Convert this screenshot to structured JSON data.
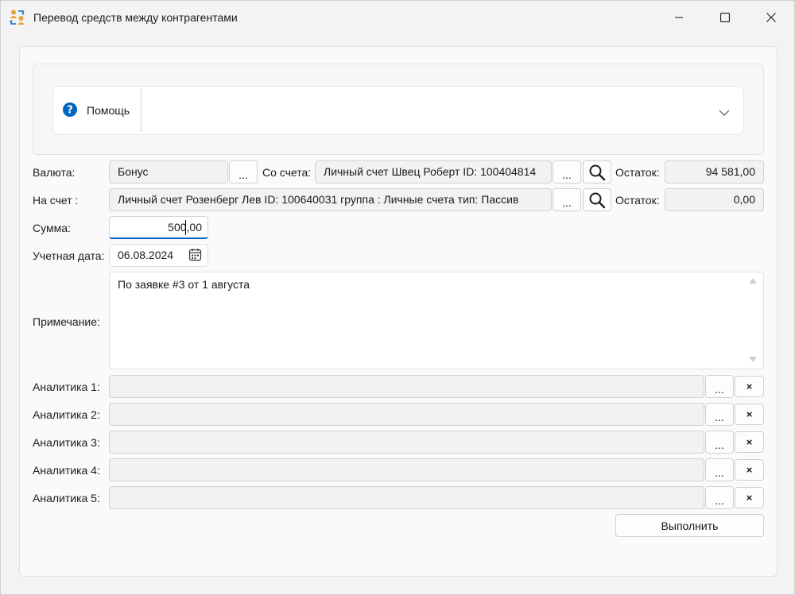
{
  "window": {
    "title": "Перевод средств между контрагентами",
    "accent": "#005fb8"
  },
  "help": {
    "label": "Помощь"
  },
  "currency": {
    "label": "Валюта:",
    "value": "Бонус",
    "browse_label": "..."
  },
  "from_account": {
    "label": "Со счета:",
    "value": "Личный счет Швец Роберт ID: 100404814",
    "browse_label": "...",
    "balance_label": "Остаток:",
    "balance_value": "94 581,00"
  },
  "to_account": {
    "label": "На счет :",
    "value": "Личный счет Розенберг Лев ID: 100640031 группа : Личные счета тип: Пассив",
    "browse_label": "...",
    "balance_label": "Остаток:",
    "balance_value": "0,00"
  },
  "amount": {
    "label": "Сумма:",
    "value": "500,00"
  },
  "date": {
    "label": "Учетная дата:",
    "value": "06.08.2024"
  },
  "note": {
    "label": "Примечание:",
    "value": "По заявке #3 от 1 августа"
  },
  "analytics": [
    {
      "label": "Аналитика 1:",
      "value": "",
      "browse_label": "...",
      "clear_label": "×"
    },
    {
      "label": "Аналитика 2:",
      "value": "",
      "browse_label": "...",
      "clear_label": "×"
    },
    {
      "label": "Аналитика 3:",
      "value": "",
      "browse_label": "...",
      "clear_label": "×"
    },
    {
      "label": "Аналитика 4:",
      "value": "",
      "browse_label": "...",
      "clear_label": "×"
    },
    {
      "label": "Аналитика 5:",
      "value": "",
      "browse_label": "...",
      "clear_label": "×"
    }
  ],
  "actions": {
    "execute_label": "Выполнить"
  }
}
